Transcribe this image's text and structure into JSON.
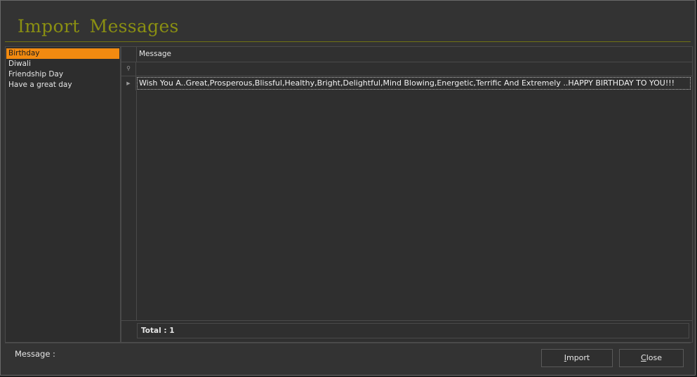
{
  "window": {
    "title": "Import  Messages"
  },
  "categories": [
    {
      "label": "Birthday",
      "selected": true
    },
    {
      "label": "Diwali",
      "selected": false
    },
    {
      "label": "Friendship Day",
      "selected": false
    },
    {
      "label": "Have a great day",
      "selected": false
    }
  ],
  "grid": {
    "column_header": "Message",
    "filter_value": "",
    "rows": [
      {
        "message": "Wish You A..Great,Prosperous,Blissful,Healthy,Bright,Delightful,Mind Blowing,Energetic,Terrific And Extremely ..HAPPY BIRTHDAY TO YOU!!!"
      }
    ],
    "total_label": "Total : 1"
  },
  "footer": {
    "message_label": "Message :",
    "import_button": {
      "mnemonic": "I",
      "rest": "mport"
    },
    "close_button": {
      "mnemonic": "C",
      "rest": "lose"
    }
  },
  "icons": {
    "filter_row_indicator": "filter-pin-icon",
    "current_row_indicator": "row-pointer-icon"
  },
  "colors": {
    "title": "#8a8f12",
    "selection": "#f28a10",
    "background": "#333333"
  }
}
